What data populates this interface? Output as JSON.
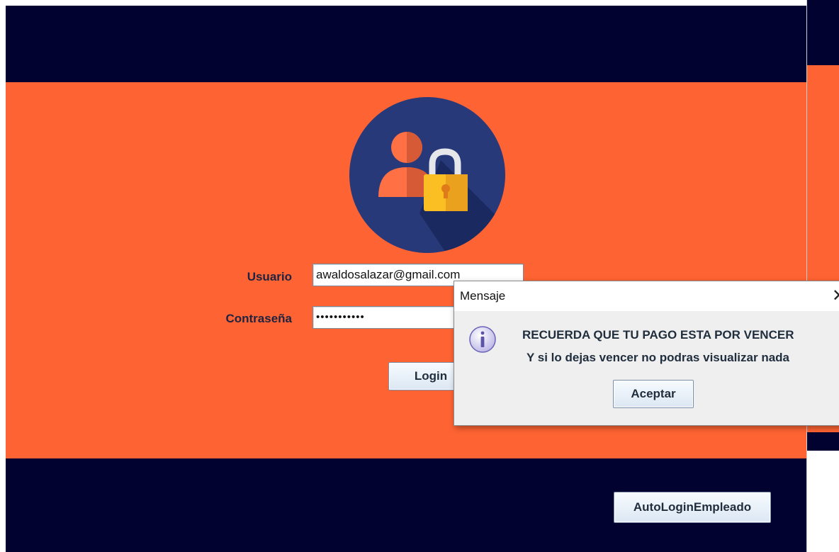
{
  "login": {
    "username_label": "Usuario",
    "username_value": "awaldosalazar@gmail.com",
    "password_label": "Contraseña",
    "password_value": "•••••••••••",
    "login_button": "Login",
    "autologin_button": "AutoLoginEmpleado"
  },
  "dialog": {
    "title": "Mensaje",
    "close_glyph": "✕",
    "line1": "RECUERDA QUE TU PAGO ESTA POR VENCER",
    "line2": "Y si lo dejas vencer no podras visualizar nada",
    "ok_button": "Aceptar",
    "icon": "info-icon"
  },
  "colors": {
    "navy": "#020230",
    "orange": "#fe6433",
    "logo_circle": "#28397a",
    "lock_yellow": "#fbbf24"
  }
}
